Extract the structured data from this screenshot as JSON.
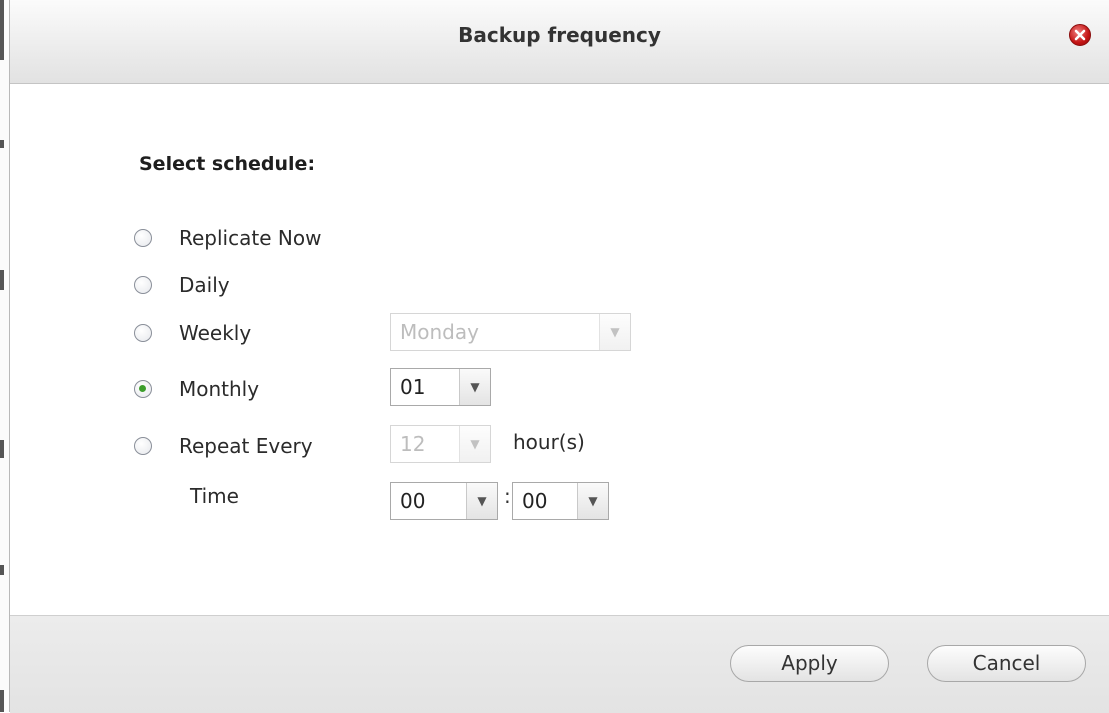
{
  "dialog": {
    "title": "Backup frequency",
    "close_icon": "close-icon"
  },
  "schedule": {
    "label": "Select schedule:",
    "options": [
      {
        "label": "Replicate Now",
        "checked": false
      },
      {
        "label": "Daily",
        "checked": false
      },
      {
        "label": "Weekly",
        "checked": false
      },
      {
        "label": "Monthly",
        "checked": true
      },
      {
        "label": "Repeat Every",
        "checked": false
      }
    ],
    "weekly_day": "Monday",
    "monthly_day": "01",
    "repeat_hours": "12",
    "repeat_unit": "hour(s)",
    "time_label": "Time",
    "time_hour": "00",
    "time_separator": ":",
    "time_minute": "00"
  },
  "footer": {
    "apply_label": "Apply",
    "cancel_label": "Cancel"
  },
  "colors": {
    "checked_radio": "#3d9e2c",
    "close_button": "#c41414"
  }
}
